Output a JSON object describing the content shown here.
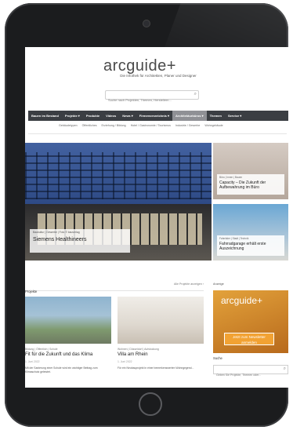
{
  "brand": {
    "logo": "arcguide",
    "plus": "+",
    "tagline": "Die Infothek für Architekten, Planer und Designer"
  },
  "search": {
    "placeholder": "Suche nach Projekten, Themen, Herstellern...",
    "icon": "search-icon"
  },
  "mainnav": {
    "items": [
      "Bauen im Bestand",
      "Projekte ▾",
      "Produkte",
      "Videos",
      "News ▾",
      "Firmenverzeichnis ▾",
      "Architekturbüros ▾",
      "Themen",
      "Service ▾"
    ]
  },
  "subnav": {
    "items": [
      "Gebäudetypen",
      "Öffentliches",
      "Erziehung / Bildung",
      "Hotel / Gastronomie / Tourismus",
      "Industrie / Gewerbe",
      "Wohngebäude"
    ]
  },
  "hero": {
    "tags": "Baukultur | Gewerbe | Foto © bauverlag",
    "title": "Siemens Healthineers"
  },
  "side_cards": [
    {
      "tags": "Büro | Innen | Bauen",
      "title": "Capacity – Die Zukunft der Aufbewahrung im Büro"
    },
    {
      "tags": "Fahrräder | Stadt | Technik",
      "title": "Fahrradgarage erhält erste Auszeichnung"
    }
  ],
  "projects": {
    "label": "Projekte",
    "more": "Alle Projekte anzeigen ›",
    "cards": [
      {
        "tags": "Bildung | Öffentlich | Schule",
        "title": "Fit für die Zukunft und das Klima",
        "date": "1. Juni 2022",
        "teaser": "Mit der Sanierung einer Schule wird ein wichtiger Beitrag zum Klimaschutz geleistet."
      },
      {
        "tags": "Wohnen | Düsseldorf | Aufstockung",
        "title": "Villa am Rhein",
        "date": "1. Juni 2022",
        "teaser": "Für ein Neubauprojekt in einer bemerkenswerten Wohngegend..."
      }
    ]
  },
  "ad": {
    "label": "Anzeige",
    "logo": "arcguide+",
    "cta": "Jetzt zum Newsletter anmelden"
  },
  "sidebar_search": {
    "label": "Suche",
    "placeholder": "Geben Sie Projekte, Themen oder..."
  },
  "colors": {
    "nav_bg": "#3b3e43",
    "nav_active": "#8f9095",
    "ad_orange": "#e3a23b",
    "tablet_frame": "#1b1c1e"
  }
}
